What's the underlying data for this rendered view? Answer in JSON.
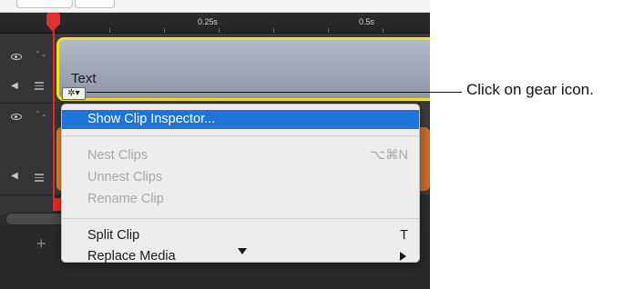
{
  "ruler": {
    "labels": [
      "0.25s",
      "0.5s"
    ]
  },
  "tracks": {
    "text_clip_label": "Text"
  },
  "icons": {
    "gear": "gear-icon",
    "eye": "eye-icon",
    "speaker": "speaker-icon",
    "chevron_updown": "chevron-updown-icon",
    "hamburger": "hamburger-icon",
    "plus": "plus-icon",
    "submenu_arrow": "chevron-right-icon",
    "scroll_down": "chevron-down-icon"
  },
  "glyphs": {
    "gear": "✲▾",
    "chev": "⌃⌄",
    "speaker": "◀",
    "plus": "+"
  },
  "context_menu": {
    "highlighted": "Show Clip Inspector...",
    "items": [
      {
        "label": "Show Clip Inspector...",
        "shortcut": "",
        "state": "highlighted"
      },
      {
        "label": "Nest Clips",
        "shortcut": "⌥⌘N",
        "state": "disabled"
      },
      {
        "label": "Unnest Clips",
        "shortcut": "",
        "state": "disabled"
      },
      {
        "label": "Rename Clip",
        "shortcut": "",
        "state": "disabled"
      },
      {
        "label": "Split Clip",
        "shortcut": "T",
        "state": "enabled"
      },
      {
        "label": "Replace Media",
        "shortcut": "",
        "state": "enabled"
      }
    ]
  },
  "callout": {
    "text": "Click on gear icon."
  },
  "colors": {
    "highlight": "#1f74d8",
    "playhead": "#e0302a",
    "clip_border": "#f3e11c",
    "text_clip": "#9aa0b2",
    "audio_clip": "#d98a3a"
  }
}
